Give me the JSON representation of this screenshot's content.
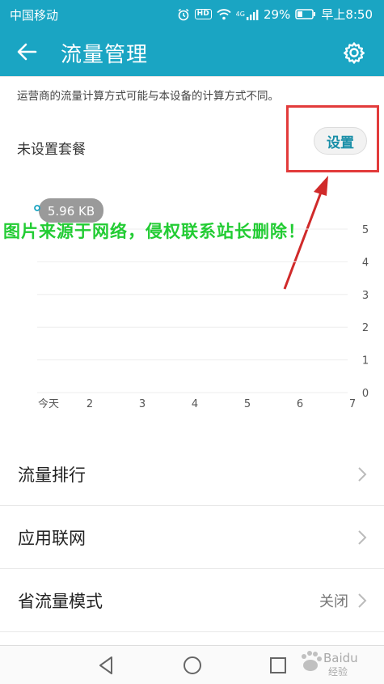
{
  "status_bar": {
    "carrier": "中国移动",
    "hd": "HD",
    "network": "4G",
    "battery": "29%",
    "time": "早上8:50"
  },
  "app_bar": {
    "title": "流量管理",
    "back_icon": "arrow-left-icon",
    "settings_icon": "gear-icon"
  },
  "notice": "运营商的流量计算方式可能与本设备的计算方式不同。",
  "plan": {
    "label": "未设置套餐",
    "set_button": "设置"
  },
  "watermark": "图片来源于网络，侵权联系站长删除！",
  "chart_data": {
    "type": "line",
    "tooltip": "5.96 KB",
    "categories": [
      "今天",
      "2",
      "3",
      "4",
      "5",
      "6",
      "7"
    ],
    "values": [
      0.006,
      null,
      null,
      null,
      null,
      null,
      null
    ],
    "y_ticks": [
      "0",
      "1",
      "2",
      "3",
      "4",
      "5"
    ],
    "ylim": [
      0,
      5
    ],
    "grid": true,
    "line_color": "#1aa5c3"
  },
  "list": [
    {
      "label": "流量排行",
      "value": ""
    },
    {
      "label": "应用联网",
      "value": ""
    },
    {
      "label": "省流量模式",
      "value": "关闭"
    }
  ],
  "brand": {
    "name": "Baidu",
    "sub": "经验"
  },
  "colors": {
    "primary": "#1aa5c3",
    "highlight": "#e23b3b",
    "watermark": "#22cc33"
  }
}
